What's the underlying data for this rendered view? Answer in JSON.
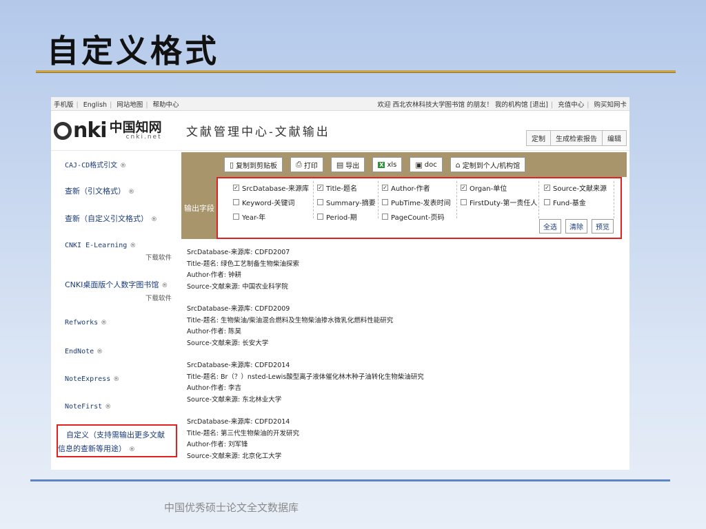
{
  "slide": {
    "title": "自定义格式",
    "footer": "中国优秀硕士论文全文数据库"
  },
  "topbar": {
    "left_links": [
      "手机版",
      "English",
      "网站地图",
      "帮助中心"
    ],
    "welcome": "欢迎 西北农林科技大学图书馆 的朋友！",
    "right_links": [
      "我的机构馆",
      "[退出]",
      "充值中心",
      "购买知网卡"
    ]
  },
  "header": {
    "logo_latin": "nki",
    "logo_cn": "中国知网",
    "logo_url": "cnki.net",
    "title": "文献管理中心-文献输出",
    "tabs": [
      "定制",
      "生成检索报告",
      "编辑"
    ]
  },
  "sidebar": {
    "items": [
      {
        "label": "CAJ-CD格式引文",
        "sub": ""
      },
      {
        "label": "查新（引文格式）",
        "sub": ""
      },
      {
        "label": "查新（自定义引文格式）",
        "sub": ""
      },
      {
        "label": "CNKI E-Learning",
        "sub": "下载软件"
      },
      {
        "label": "CNKI桌面版个人数字图书馆",
        "sub": "下载软件"
      },
      {
        "label": "Refworks",
        "sub": ""
      },
      {
        "label": "EndNote",
        "sub": ""
      },
      {
        "label": "NoteExpress",
        "sub": ""
      },
      {
        "label": "NoteFirst",
        "sub": ""
      }
    ],
    "highlight_line1": "自定义（支持需输出更多文献",
    "highlight_line2": "信息的查新等用途）"
  },
  "toolbar": {
    "copy": "复制到剪贴板",
    "print": "打印",
    "export": "导出",
    "xls": "xls",
    "doc": "doc",
    "custom": "定制到个人/机构馆"
  },
  "fields": {
    "label": "输出字段",
    "items": [
      {
        "label": "SrcDatabase-来源库",
        "checked": true
      },
      {
        "label": "Title-题名",
        "checked": true
      },
      {
        "label": "Author-作者",
        "checked": true
      },
      {
        "label": "Organ-单位",
        "checked": true
      },
      {
        "label": "Source-文献来源",
        "checked": true
      },
      {
        "label": "Keyword-关键词",
        "checked": false
      },
      {
        "label": "Summary-摘要",
        "checked": false
      },
      {
        "label": "PubTime-发表时间",
        "checked": false
      },
      {
        "label": "FirstDuty-第一责任人",
        "checked": false
      },
      {
        "label": "Fund-基金",
        "checked": false
      },
      {
        "label": "Year-年",
        "checked": false
      },
      {
        "label": "Period-期",
        "checked": false
      },
      {
        "label": "PageCount-页码",
        "checked": false
      }
    ],
    "buttons": [
      "全选",
      "清除",
      "预览"
    ]
  },
  "records": [
    [
      "SrcDatabase-来源库: CDFD2007",
      "Title-题名: 绿色工艺制备生物柴油探索",
      "Author-作者: 钟耕",
      "Source-文献来源: 中国农业科学院"
    ],
    [
      "SrcDatabase-来源库: CDFD2009",
      "Title-题名: 生物柴油/柴油混合燃料及生物柴油掺水微乳化燃料性能研究",
      "Author-作者: 陈昊",
      "Source-文献来源: 长安大学"
    ],
    [
      "SrcDatabase-来源库: CDFD2014",
      "Title-题名: Br（？）nsted-Lewis酸型离子液体催化林木种子油转化生物柴油研究",
      "Author-作者: 李吉",
      "Source-文献来源: 东北林业大学"
    ],
    [
      "SrcDatabase-来源库: CDFD2014",
      "Title-题名: 第三代生物柴油的开发研究",
      "Author-作者: 刘军锋",
      "Source-文献来源: 北京化工大学"
    ]
  ]
}
